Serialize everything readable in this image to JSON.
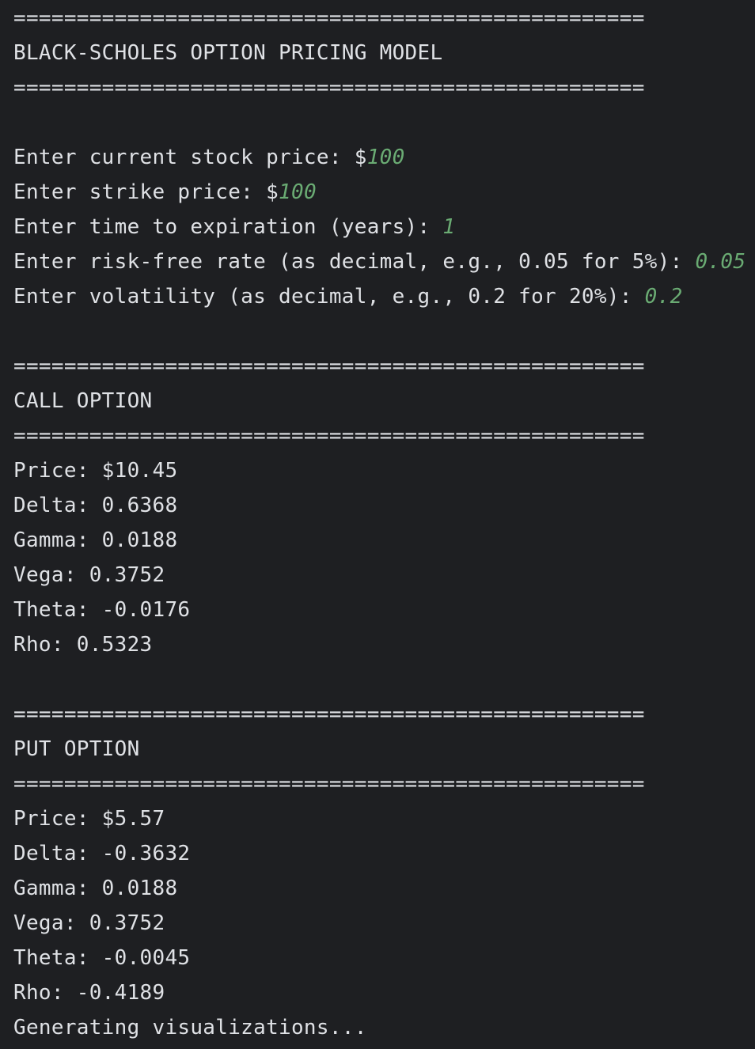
{
  "console": {
    "divider": "==================================================",
    "title": "BLACK-SCHOLES OPTION PRICING MODEL",
    "inputs": [
      {
        "prompt": "Enter current stock price: $",
        "value": "100"
      },
      {
        "prompt": "Enter strike price: $",
        "value": "100"
      },
      {
        "prompt": "Enter time to expiration (years): ",
        "value": "1"
      },
      {
        "prompt": "Enter risk-free rate (as decimal, e.g., 0.05 for 5%): ",
        "value": "0.05"
      },
      {
        "prompt": "Enter volatility (as decimal, e.g., 0.2 for 20%): ",
        "value": "0.2"
      }
    ],
    "call": {
      "header": "CALL OPTION",
      "lines": [
        "Price: $10.45",
        "Delta: 0.6368",
        "Gamma: 0.0188",
        "Vega: 0.3752",
        "Theta: -0.0176",
        "Rho: 0.5323"
      ]
    },
    "put": {
      "header": "PUT OPTION",
      "lines": [
        "Price: $5.57",
        "Delta: -0.3632",
        "Gamma: 0.0188",
        "Vega: 0.3752",
        "Theta: -0.0045",
        "Rho: -0.4189"
      ]
    },
    "status": "Generating visualizations..."
  },
  "colors": {
    "background": "#1e1f22",
    "text": "#dfe1e5",
    "input": "#6aab73"
  }
}
